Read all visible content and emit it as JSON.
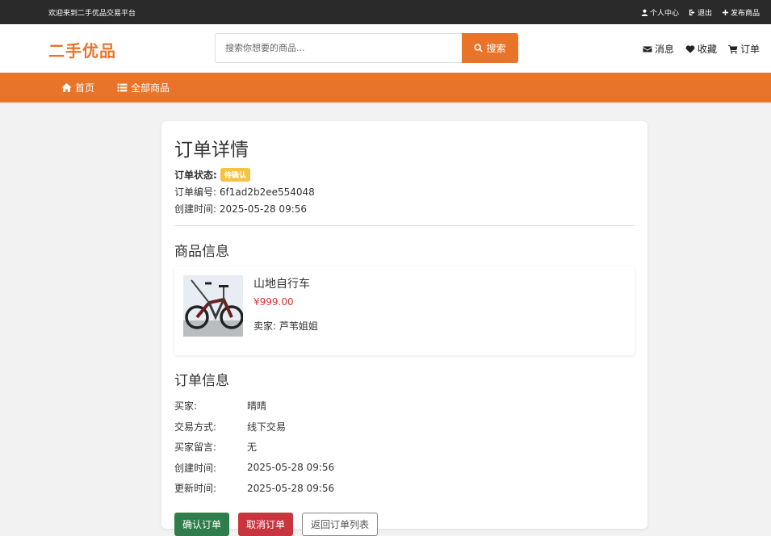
{
  "topbar": {
    "welcome": "欢迎来到二手优品交易平台",
    "links": [
      {
        "label": "个人中心",
        "icon": "user-icon"
      },
      {
        "label": "退出",
        "icon": "logout-icon"
      },
      {
        "label": "发布商品",
        "icon": "plus-icon"
      }
    ]
  },
  "header": {
    "logo": "二手优品",
    "search": {
      "placeholder": "搜索你想要的商品...",
      "button": "搜索"
    },
    "nav": [
      {
        "label": "消息",
        "icon": "envelope-icon"
      },
      {
        "label": "收藏",
        "icon": "heart-icon"
      },
      {
        "label": "订单",
        "icon": "cart-icon"
      }
    ]
  },
  "navbar": {
    "items": [
      {
        "label": "首页",
        "icon": "home-icon"
      },
      {
        "label": "全部商品",
        "icon": "list-icon"
      }
    ]
  },
  "order": {
    "title": "订单详情",
    "status_label": "订单状态:",
    "status": "待确认",
    "number_label": "订单编号:",
    "number": "6f1ad2b2ee554048",
    "created_label": "创建时间:",
    "created": "2025-05-28 09:56"
  },
  "product_section": {
    "title": "商品信息",
    "name": "山地自行车",
    "price": "¥999.00",
    "seller_label": "卖家:",
    "seller": "芦苇姐姐"
  },
  "info_section": {
    "title": "订单信息",
    "rows": [
      {
        "key": "买家:",
        "value": "晴晴"
      },
      {
        "key": "交易方式:",
        "value": "线下交易"
      },
      {
        "key": "买家留言:",
        "value": "无"
      },
      {
        "key": "创建时间:",
        "value": "2025-05-28 09:56"
      },
      {
        "key": "更新时间:",
        "value": "2025-05-28 09:56"
      }
    ]
  },
  "actions": {
    "confirm": "确认订单",
    "cancel": "取消订单",
    "back": "返回订单列表"
  },
  "colors": {
    "brand": "#e8742a",
    "topbar": "#2a2a2a",
    "confirm": "#2e7d4b",
    "cancel": "#c9353e",
    "badge": "#f5c342"
  }
}
